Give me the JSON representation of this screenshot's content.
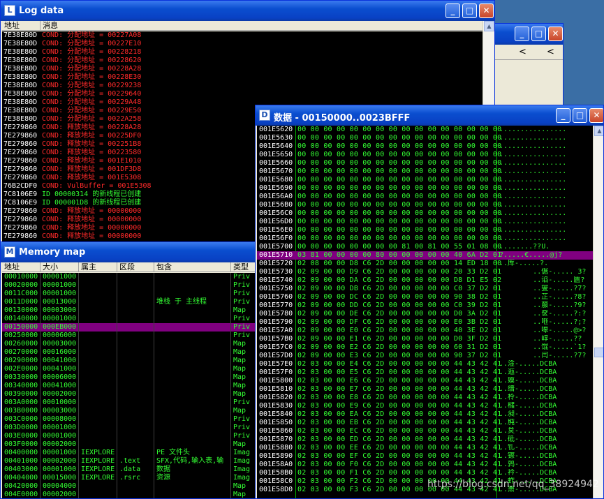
{
  "log": {
    "title": "Log data",
    "col_address": "地址",
    "col_message": "消息",
    "rows": [
      {
        "addr": "7E38E80D",
        "msg": "COND: 分配地址 = 00227A08",
        "c": "#ff2a2a"
      },
      {
        "addr": "7E38E80D",
        "msg": "COND: 分配地址 = 00227E10",
        "c": "#ff2a2a"
      },
      {
        "addr": "7E38E80D",
        "msg": "COND: 分配地址 = 00228218",
        "c": "#ff2a2a"
      },
      {
        "addr": "7E38E80D",
        "msg": "COND: 分配地址 = 00228620",
        "c": "#ff2a2a"
      },
      {
        "addr": "7E38E80D",
        "msg": "COND: 分配地址 = 00228A28",
        "c": "#ff2a2a"
      },
      {
        "addr": "7E38E80D",
        "msg": "COND: 分配地址 = 00228E30",
        "c": "#ff2a2a"
      },
      {
        "addr": "7E38E80D",
        "msg": "COND: 分配地址 = 00229238",
        "c": "#ff2a2a"
      },
      {
        "addr": "7E38E80D",
        "msg": "COND: 分配地址 = 00229640",
        "c": "#ff2a2a"
      },
      {
        "addr": "7E38E80D",
        "msg": "COND: 分配地址 = 00229A48",
        "c": "#ff2a2a"
      },
      {
        "addr": "7E38E80D",
        "msg": "COND: 分配地址 = 00229E50",
        "c": "#ff2a2a"
      },
      {
        "addr": "7E38E80D",
        "msg": "COND: 分配地址 = 0022A258",
        "c": "#ff2a2a"
      },
      {
        "addr": "7E279860",
        "msg": "COND: 释放地址 = 00228A28",
        "c": "#ff2a2a"
      },
      {
        "addr": "7E279860",
        "msg": "COND: 释放地址 = 00225DF0",
        "c": "#ff2a2a"
      },
      {
        "addr": "7E279860",
        "msg": "COND: 释放地址 = 002251B8",
        "c": "#ff2a2a"
      },
      {
        "addr": "7E279860",
        "msg": "COND: 释放地址 = 00223580",
        "c": "#ff2a2a"
      },
      {
        "addr": "7E279860",
        "msg": "COND: 释放地址 = 001E1010",
        "c": "#ff2a2a"
      },
      {
        "addr": "7E279860",
        "msg": "COND: 释放地址 = 001DF3D8",
        "c": "#ff2a2a"
      },
      {
        "addr": "7E279860",
        "msg": "COND: 释放地址 = 001E5308",
        "c": "#ff2a2a"
      },
      {
        "addr": "76B2CDF0",
        "msg": "COND: VulBuffer = 001E5308",
        "c": "#ff2a2a"
      },
      {
        "addr": "7C8106E9",
        "msg": "ID 00000314 的新线程已创建",
        "c": "#33ff33"
      },
      {
        "addr": "7C8106E9",
        "msg": "ID 000001D8 的新线程已创建",
        "c": "#33ff33"
      },
      {
        "addr": "7E279860",
        "msg": "COND: 释放地址 = 00000000",
        "c": "#ff2a2a"
      },
      {
        "addr": "7E279860",
        "msg": "COND: 释放地址 = 00000000",
        "c": "#ff2a2a"
      },
      {
        "addr": "7E279860",
        "msg": "COND: 释放地址 = 00000000",
        "c": "#ff2a2a"
      },
      {
        "addr": "7E279860",
        "msg": "COND: 释放地址 = 00000000",
        "c": "#ff2a2a"
      }
    ]
  },
  "background_window": {
    "left_arrow": "<",
    "right_arrow": "<"
  },
  "memmap": {
    "title": "Memory map",
    "headers": [
      "地址",
      "大小",
      "属主",
      "区段",
      "包含",
      "类型"
    ],
    "rows": [
      {
        "addr": "00010000",
        "size": "00001000",
        "owner": "",
        "section": "",
        "contains": "",
        "type": "Priv"
      },
      {
        "addr": "00020000",
        "size": "00001000",
        "owner": "",
        "section": "",
        "contains": "",
        "type": "Priv"
      },
      {
        "addr": "0011C000",
        "size": "00001000",
        "owner": "",
        "section": "",
        "contains": "",
        "type": "Priv"
      },
      {
        "addr": "0011D000",
        "size": "00013000",
        "owner": "",
        "section": "",
        "contains": "堆栈 于 主线程",
        "type": "Priv"
      },
      {
        "addr": "00130000",
        "size": "00003000",
        "owner": "",
        "section": "",
        "contains": "",
        "type": "Map"
      },
      {
        "addr": "00140000",
        "size": "00001000",
        "owner": "",
        "section": "",
        "contains": "",
        "type": "Priv"
      },
      {
        "addr": "00150000",
        "size": "000EB000",
        "owner": "",
        "section": "",
        "contains": "",
        "type": "Priv",
        "selected": true
      },
      {
        "addr": "00250000",
        "size": "00006000",
        "owner": "",
        "section": "",
        "contains": "",
        "type": "Priv"
      },
      {
        "addr": "00260000",
        "size": "00003000",
        "owner": "",
        "section": "",
        "contains": "",
        "type": "Map"
      },
      {
        "addr": "00270000",
        "size": "00016000",
        "owner": "",
        "section": "",
        "contains": "",
        "type": "Map"
      },
      {
        "addr": "00290000",
        "size": "00041000",
        "owner": "",
        "section": "",
        "contains": "",
        "type": "Map"
      },
      {
        "addr": "002E0000",
        "size": "00041000",
        "owner": "",
        "section": "",
        "contains": "",
        "type": "Map"
      },
      {
        "addr": "00330000",
        "size": "00006000",
        "owner": "",
        "section": "",
        "contains": "",
        "type": "Map"
      },
      {
        "addr": "00340000",
        "size": "00041000",
        "owner": "",
        "section": "",
        "contains": "",
        "type": "Map"
      },
      {
        "addr": "00390000",
        "size": "00002000",
        "owner": "",
        "section": "",
        "contains": "",
        "type": "Map"
      },
      {
        "addr": "003A0000",
        "size": "00010000",
        "owner": "",
        "section": "",
        "contains": "",
        "type": "Priv"
      },
      {
        "addr": "003B0000",
        "size": "00003000",
        "owner": "",
        "section": "",
        "contains": "",
        "type": "Map"
      },
      {
        "addr": "003C0000",
        "size": "00008000",
        "owner": "",
        "section": "",
        "contains": "",
        "type": "Priv"
      },
      {
        "addr": "003D0000",
        "size": "00001000",
        "owner": "",
        "section": "",
        "contains": "",
        "type": "Priv"
      },
      {
        "addr": "003E0000",
        "size": "00001000",
        "owner": "",
        "section": "",
        "contains": "",
        "type": "Priv"
      },
      {
        "addr": "003F0000",
        "size": "00002000",
        "owner": "",
        "section": "",
        "contains": "",
        "type": "Map"
      },
      {
        "addr": "00400000",
        "size": "00001000",
        "owner": "IEXPLORE",
        "section": "",
        "contains": "PE 文件头",
        "type": "Imag"
      },
      {
        "addr": "00401000",
        "size": "00002000",
        "owner": "IEXPLORE",
        "section": ".text",
        "contains": "SFX,代码,输入表,输",
        "type": "Imag"
      },
      {
        "addr": "00403000",
        "size": "00001000",
        "owner": "IEXPLORE",
        "section": ".data",
        "contains": "数据",
        "type": "Imag"
      },
      {
        "addr": "00404000",
        "size": "00015000",
        "owner": "IEXPLORE",
        "section": ".rsrc",
        "contains": "资源",
        "type": "Imag"
      },
      {
        "addr": "00420000",
        "size": "00004000",
        "owner": "",
        "section": "",
        "contains": "",
        "type": "Map"
      },
      {
        "addr": "004E0000",
        "size": "00002000",
        "owner": "",
        "section": "",
        "contains": "",
        "type": "Map"
      }
    ]
  },
  "dump": {
    "title": "数据 - 00150000..0023BFFF",
    "rows": [
      {
        "addr": "001E5620",
        "hex": "00 00 00 00 00 00 00 00 00 00 00 00 00 00 00 00",
        "ascii": "................"
      },
      {
        "addr": "001E5630",
        "hex": "00 00 00 00 00 00 00 00 00 00 00 00 00 00 00 00",
        "ascii": "................"
      },
      {
        "addr": "001E5640",
        "hex": "00 00 00 00 00 00 00 00 00 00 00 00 00 00 00 00",
        "ascii": "................"
      },
      {
        "addr": "001E5650",
        "hex": "00 00 00 00 00 00 00 00 00 00 00 00 00 00 00 00",
        "ascii": "................"
      },
      {
        "addr": "001E5660",
        "hex": "00 00 00 00 00 00 00 00 00 00 00 00 00 00 00 00",
        "ascii": "................"
      },
      {
        "addr": "001E5670",
        "hex": "00 00 00 00 00 00 00 00 00 00 00 00 00 00 00 00",
        "ascii": "................"
      },
      {
        "addr": "001E5680",
        "hex": "00 00 00 00 00 00 00 00 00 00 00 00 00 00 00 00",
        "ascii": "................"
      },
      {
        "addr": "001E5690",
        "hex": "00 00 00 00 00 00 00 00 00 00 00 00 00 00 00 00",
        "ascii": "................"
      },
      {
        "addr": "001E56A0",
        "hex": "00 00 00 00 00 00 00 00 00 00 00 00 00 00 00 00",
        "ascii": "................"
      },
      {
        "addr": "001E56B0",
        "hex": "00 00 00 00 00 00 00 00 00 00 00 00 00 00 00 00",
        "ascii": "................"
      },
      {
        "addr": "001E56C0",
        "hex": "00 00 00 00 00 00 00 00 00 00 00 00 00 00 00 00",
        "ascii": "................"
      },
      {
        "addr": "001E56D0",
        "hex": "00 00 00 00 00 00 00 00 00 00 00 00 00 00 00 00",
        "ascii": "................"
      },
      {
        "addr": "001E56E0",
        "hex": "00 00 00 00 00 00 00 00 00 00 00 00 00 00 00 00",
        "ascii": "................"
      },
      {
        "addr": "001E56F0",
        "hex": "00 00 00 00 00 00 00 00 00 00 00 00 00 00 00 00",
        "ascii": "................"
      },
      {
        "addr": "001E5700",
        "hex": "00 00 00 00 00 00 00 00 81 00 81 00 55 01 08 00",
        "ascii": "........??U\u0001\b."
      },
      {
        "addr": "001E5710",
        "hex": "03 81 00 00 00 00 80 00 00 00 00 00 40 6A D2 01",
        "ascii": "\u0003?.....€.....@j?",
        "sel": true
      },
      {
        "addr": "001E5720",
        "hex": "02 08 00 00 D8 C6 2D 00 00 00 00 00 14 ED 18 00",
        "ascii": "\u0002\b..厍-.....\u0014?\u0018."
      },
      {
        "addr": "001E5730",
        "hex": "02 09 00 00 D9 C6 2D 00 00 00 00 00 20 33 D2 01",
        "ascii": "\u0002\t..倨-..... 3?"
      },
      {
        "addr": "001E5740",
        "hex": "02 09 00 00 DA C6 2D 00 00 00 00 00 D8 D1 E5 02",
        "ascii": "\u0002\t..谄-.....匮?"
      },
      {
        "addr": "001E5750",
        "hex": "02 09 00 00 DB C6 2D 00 00 00 00 00 C0 37 D2 01",
        "ascii": "\u0002\t..燮-.....?7?"
      },
      {
        "addr": "001E5760",
        "hex": "02 09 00 00 DC C6 2D 00 00 00 00 00 90 38 D2 01",
        "ascii": "\u0002\t..芷-.....?8?"
      },
      {
        "addr": "001E5770",
        "hex": "02 09 00 00 DD C6 2D 00 00 00 00 00 C0 39 D2 01",
        "ascii": "\u0002\t..菔-.....?9?"
      },
      {
        "addr": "001E5780",
        "hex": "02 09 00 00 DE C6 2D 00 00 00 00 00 D0 3A D2 01",
        "ascii": "\u0002\t..奁-.....?:?"
      },
      {
        "addr": "001E5790",
        "hex": "02 09 00 00 DF C6 2D 00 00 00 00 00 E0 3B D2 01",
        "ascii": "\u0002\t..咂-.....?;?"
      },
      {
        "addr": "001E57A0",
        "hex": "02 09 00 00 E0 C6 2D 00 00 00 00 00 40 3E D2 01",
        "ascii": "\u0002\t..嗥-.....@>?"
      },
      {
        "addr": "001E57B0",
        "hex": "02 09 00 00 E1 C6 2D 00 00 00 00 00 D0 3F D2 01",
        "ascii": "\u0002\t..崞-.....??"
      },
      {
        "addr": "001E57C0",
        "hex": "02 09 00 00 E2 C6 2D 00 00 00 00 00 60 31 D2 01",
        "ascii": "\u0002\t..馄-.....`1?"
      },
      {
        "addr": "001E57D0",
        "hex": "02 09 00 00 E3 C6 2D 00 00 00 00 00 90 37 D2 01",
        "ascii": "\u0002\t..闫-.....?7?"
      },
      {
        "addr": "001E57E0",
        "hex": "02 03 00 00 E4 C6 2D 00 00 00 00 00 44 43 42 41",
        "ascii": "\u0002\u0003..淦-.....DCBA"
      },
      {
        "addr": "001E57F0",
        "hex": "02 03 00 00 E5 C6 2D 00 00 00 00 00 44 43 42 41",
        "ascii": "\u0002\u0003..迤-.....DCBA"
      },
      {
        "addr": "001E5800",
        "hex": "02 03 00 00 E6 C6 2D 00 00 00 00 00 44 43 42 41",
        "ascii": "\u0002\u0003..嫫-.....DCBA"
      },
      {
        "addr": "001E5810",
        "hex": "02 03 00 00 E7 C6 2D 00 00 00 00 00 44 43 42 41",
        "ascii": "\u0002\u0003..缙-.....DCBA"
      },
      {
        "addr": "001E5820",
        "hex": "02 03 00 00 E8 C6 2D 00 00 00 00 00 44 43 42 41",
        "ascii": "\u0002\u0003..柃-.....DCBA"
      },
      {
        "addr": "001E5830",
        "hex": "02 03 00 00 E9 C6 2D 00 00 00 00 00 44 43 42 41",
        "ascii": "\u0002\u0003..槠-.....DCBA"
      },
      {
        "addr": "001E5840",
        "hex": "02 03 00 00 EA C6 2D 00 00 00 00 00 44 43 42 41",
        "ascii": "\u0002\u0003..昶-.....DCBA"
      },
      {
        "addr": "001E5850",
        "hex": "02 03 00 00 EB C6 2D 00 00 00 00 00 44 43 42 41",
        "ascii": "\u0002\u0003..肫-.....DCBA"
      },
      {
        "addr": "001E5860",
        "hex": "02 03 00 00 EC C6 2D 00 00 00 00 00 44 43 42 41",
        "ascii": "\u0002\u0003..炱-.....DCBA"
      },
      {
        "addr": "001E5870",
        "hex": "02 03 00 00 ED C6 2D 00 00 00 00 00 44 43 42 41",
        "ascii": "\u0002\u0003..砥-.....DCBA"
      },
      {
        "addr": "001E5880",
        "hex": "02 03 00 00 EE C6 2D 00 00 00 00 00 44 43 42 41",
        "ascii": "\u0002\u0003..钆-.....DCBA"
      },
      {
        "addr": "001E5890",
        "hex": "02 03 00 00 EF C6 2D 00 00 00 00 00 44 43 42 41",
        "ascii": "\u0002\u0003..镲-.....DCBA"
      },
      {
        "addr": "001E58A0",
        "hex": "02 03 00 00 F0 C6 2D 00 00 00 00 00 44 43 42 41",
        "ascii": "\u0002\u0003..鹑-.....DCBA"
      },
      {
        "addr": "001E58B0",
        "hex": "02 03 00 00 F1 C6 2D 00 00 00 00 00 44 43 42 41",
        "ascii": "\u0002\u0003..衿-.....DCBA"
      },
      {
        "addr": "001E58C0",
        "hex": "02 03 00 00 F2 C6 2D 00 00 00 00 00 44 43 42 41",
        "ascii": "\u0002\u0003..蚱-.....DCBA"
      },
      {
        "addr": "001E58D0",
        "hex": "02 03 00 00 F3 C6 2D 00 00 00 00 00 44 43 42 41",
        "ascii": "\u0002\u0003..箫-.....DCBA"
      }
    ]
  },
  "watermark": "https://blog.csdn.net/qq_38924942",
  "colors": {
    "log_addr": "#ffffff",
    "mm_addr": "#33ff33",
    "mm_type": "#33ff33",
    "dump_addr": "#ffffff",
    "dump_hex": "#33ff33",
    "selection": "#800080"
  }
}
